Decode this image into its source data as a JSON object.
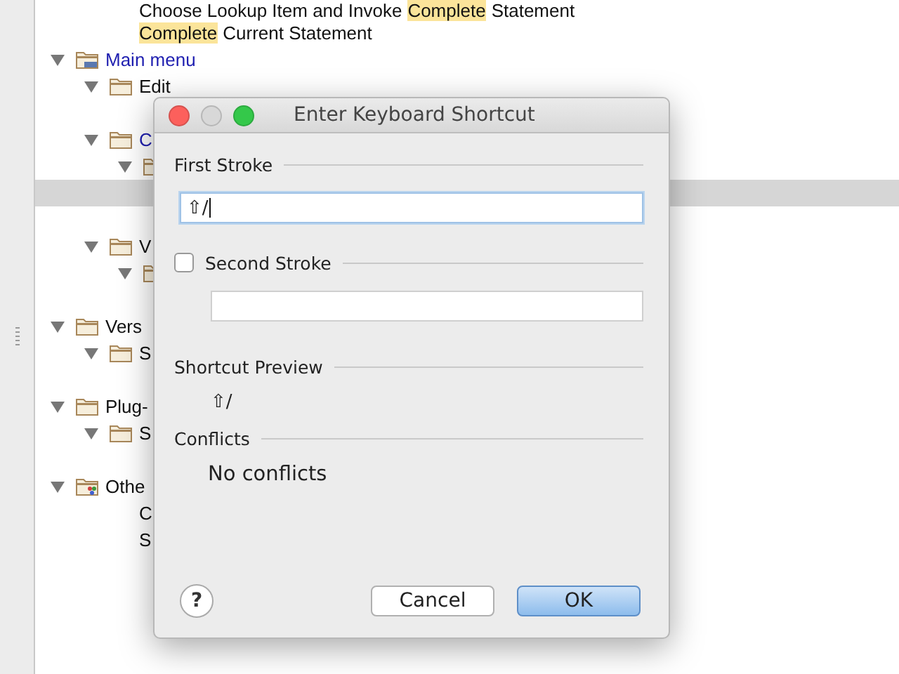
{
  "partial_items": [
    {
      "segments": [
        {
          "text": "Choose Lookup Item and Invoke",
          "highlight": false
        },
        {
          "text": "Complete",
          "highlight": true
        },
        {
          "text": "Statement",
          "highlight": false
        }
      ]
    },
    {
      "segments": [
        {
          "text": "Complete",
          "highlight": true
        },
        {
          "text": "Current Statement",
          "highlight": false
        }
      ]
    }
  ],
  "tree": [
    {
      "label": "Main menu",
      "kind": "menu",
      "modified": true,
      "expanded": true,
      "children": [
        {
          "label": "Edit",
          "kind": "folder",
          "modified": false,
          "expanded": true,
          "children": [
            {
              "kind": "hidden",
              "selected": false
            }
          ]
        },
        {
          "label": "C",
          "kind": "folder",
          "modified": true,
          "expanded": true,
          "children": [
            {
              "kind": "folder",
              "expanded": true,
              "children": [
                {
                  "kind": "hidden",
                  "selected": true
                },
                {
                  "kind": "hidden",
                  "selected": false
                }
              ]
            }
          ]
        },
        {
          "label": "V",
          "kind": "folder",
          "modified": false,
          "expanded": true,
          "children": [
            {
              "kind": "folder",
              "expanded": true,
              "children": [
                {
                  "kind": "hidden",
                  "selected": false
                }
              ]
            }
          ]
        }
      ]
    },
    {
      "label": "Vers",
      "kind": "folder",
      "modified": false,
      "expanded": true,
      "children": [
        {
          "label": "S",
          "kind": "folder",
          "modified": false,
          "expanded": true,
          "children": [
            {
              "kind": "hidden",
              "selected": false
            }
          ]
        }
      ]
    },
    {
      "label": "Plug-",
      "kind": "folder",
      "modified": false,
      "expanded": true,
      "children": [
        {
          "label": "S",
          "kind": "folder",
          "modified": false,
          "expanded": true,
          "children": [
            {
              "kind": "hidden",
              "selected": false
            }
          ]
        }
      ]
    },
    {
      "label": "Othe",
      "kind": "plugins",
      "modified": false,
      "expanded": true,
      "children": [
        {
          "label": "C",
          "kind": "action"
        },
        {
          "label": "S",
          "kind": "action"
        }
      ]
    }
  ],
  "dialog": {
    "title": "Enter Keyboard Shortcut",
    "first_stroke": {
      "label": "First Stroke",
      "value": "⇧/"
    },
    "second_stroke": {
      "label": "Second Stroke",
      "checked": false
    },
    "preview": {
      "label": "Shortcut Preview",
      "value": "⇧/"
    },
    "conflicts": {
      "label": "Conflicts",
      "text": "No conflicts"
    },
    "help": "?",
    "buttons": [
      {
        "label": "Cancel",
        "default": false
      },
      {
        "label": "OK",
        "default": true
      }
    ]
  }
}
